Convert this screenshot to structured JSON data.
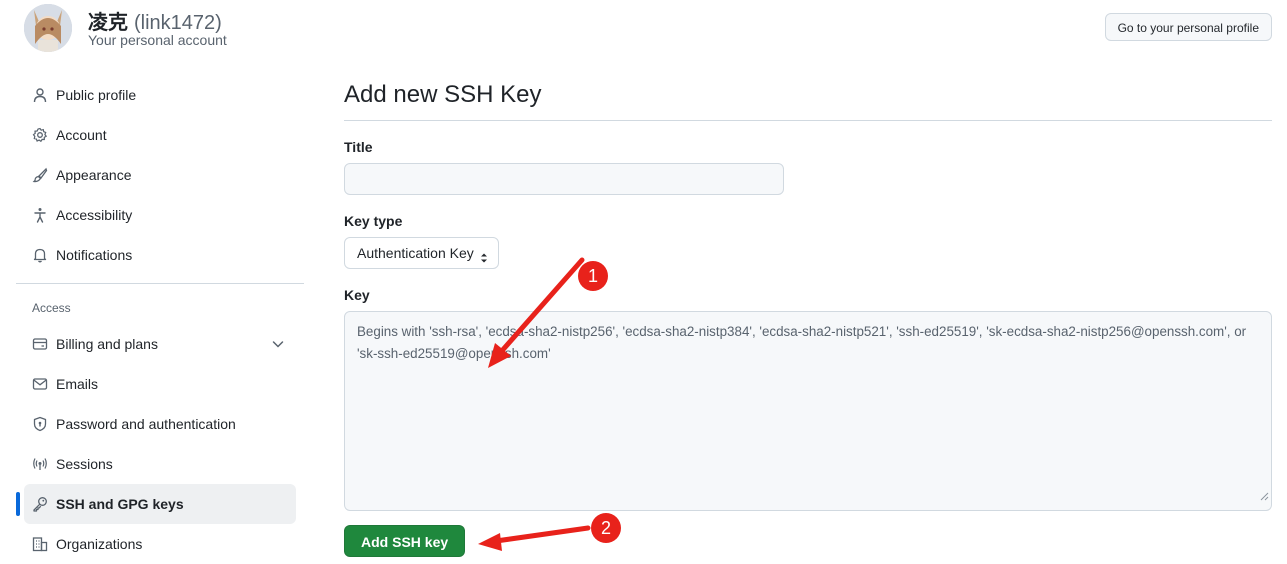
{
  "header": {
    "name": "凌克",
    "handle": "(link1472)",
    "subtitle": "Your personal account",
    "profile_button": "Go to your personal profile"
  },
  "sidebar": {
    "items": [
      {
        "label": "Public profile",
        "icon": "person-icon"
      },
      {
        "label": "Account",
        "icon": "gear-icon"
      },
      {
        "label": "Appearance",
        "icon": "paintbrush-icon"
      },
      {
        "label": "Accessibility",
        "icon": "accessibility-icon"
      },
      {
        "label": "Notifications",
        "icon": "bell-icon"
      }
    ],
    "access_label": "Access",
    "access_items": [
      {
        "label": "Billing and plans",
        "icon": "credit-card-icon"
      },
      {
        "label": "Emails",
        "icon": "mail-icon"
      },
      {
        "label": "Password and authentication",
        "icon": "shield-lock-icon"
      },
      {
        "label": "Sessions",
        "icon": "broadcast-icon"
      },
      {
        "label": "SSH and GPG keys",
        "icon": "key-icon",
        "active": true
      },
      {
        "label": "Organizations",
        "icon": "organization-icon"
      }
    ]
  },
  "main": {
    "title": "Add new SSH Key",
    "title_label": "Title",
    "title_value": "",
    "key_type_label": "Key type",
    "key_type_value": "Authentication Key",
    "key_label": "Key",
    "key_placeholder": "Begins with 'ssh-rsa', 'ecdsa-sha2-nistp256', 'ecdsa-sha2-nistp384', 'ecdsa-sha2-nistp521', 'ssh-ed25519', 'sk-ecdsa-sha2-nistp256@openssh.com', or 'sk-ssh-ed25519@openssh.com'",
    "submit_label": "Add SSH key"
  },
  "annotations": {
    "badge1": "1",
    "badge2": "2",
    "color": "#e8221b"
  },
  "colors": {
    "accent": "#0969da",
    "primary_button": "#1f883d"
  }
}
